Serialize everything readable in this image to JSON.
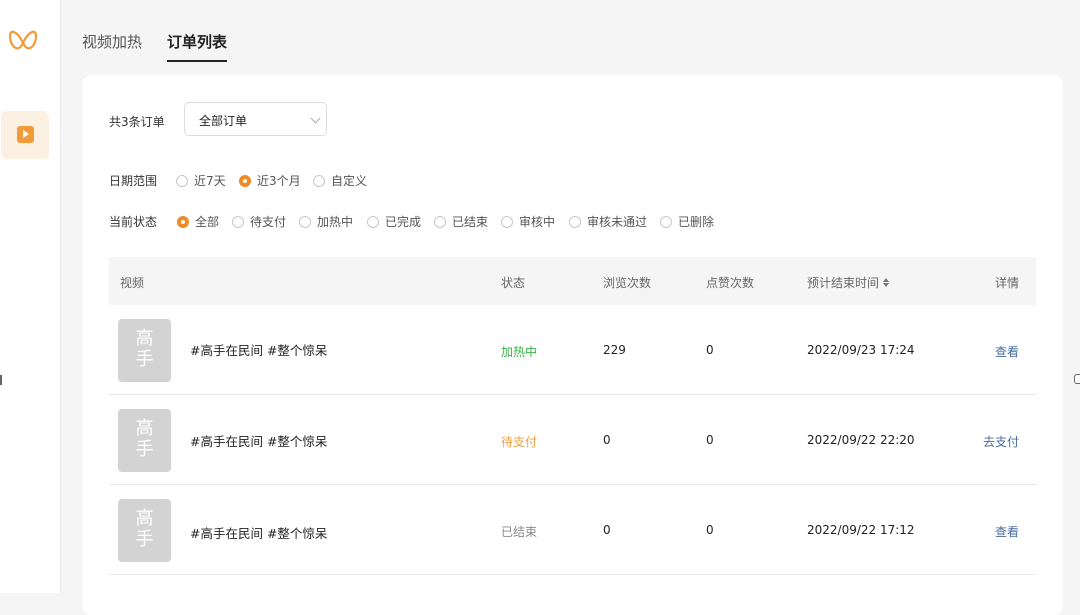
{
  "tabs": [
    "视频加热",
    "订单列表"
  ],
  "order_count_label": "共3条订单",
  "order_filter": {
    "selected": "全部订单"
  },
  "date_filter": {
    "label": "日期范围",
    "options": [
      "近7天",
      "近3个月",
      "自定义"
    ],
    "selected": "近3个月"
  },
  "status_filter": {
    "label": "当前状态",
    "options": [
      "全部",
      "待支付",
      "加热中",
      "已完成",
      "已结束",
      "审核中",
      "审核未通过",
      "已删除"
    ],
    "selected": "全部"
  },
  "table": {
    "columns": [
      "视频",
      "状态",
      "浏览次数",
      "点赞次数",
      "预计结束时间",
      "详情"
    ],
    "rows": [
      {
        "thumb_text": [
          "高",
          "手"
        ],
        "title": "#高手在民间 #整个惊呆",
        "status": "加热中",
        "views": "229",
        "likes": "0",
        "end_time": "2022/09/23 17:24",
        "action": "查看"
      },
      {
        "thumb_text": [
          "高",
          "手"
        ],
        "title": "#高手在民间 #整个惊呆",
        "status": "待支付",
        "views": "0",
        "likes": "0",
        "end_time": "2022/09/22 22:20",
        "action": "去支付"
      },
      {
        "thumb_text": [
          "高",
          "手"
        ],
        "title": "#高手在民间 #整个惊呆",
        "status": "已结束",
        "views": "0",
        "likes": "0",
        "end_time": "2022/09/22 17:12",
        "action": "查看"
      }
    ]
  },
  "colors": {
    "accent": "#f08a24",
    "status_heating": "#3ab54a",
    "status_pending": "#f0a040",
    "status_ended": "#888888",
    "link": "#4a6c9e"
  },
  "icons": {
    "logo": "butterfly-logo-icon",
    "nav": "video-play-icon",
    "sort": "sort-icon"
  }
}
